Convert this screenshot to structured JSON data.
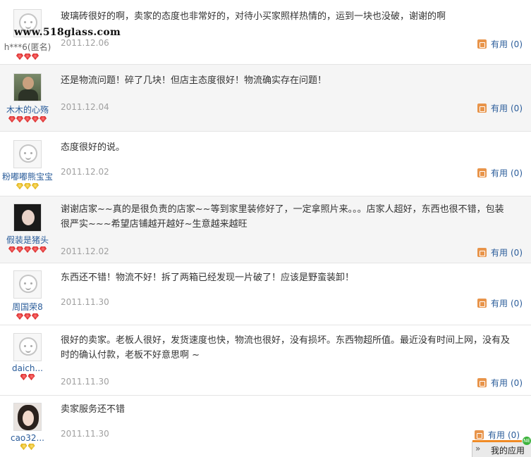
{
  "watermark": "www.518glass.com",
  "useful_label": "有用",
  "reviews": [
    {
      "user": "h***6(匿名)",
      "text": "玻璃砖很好的啊，卖家的态度也非常好的，对待小买家照样热情的，运到一块也没破，谢谢的啊",
      "date": "2011.12.06",
      "useful": "(0)",
      "rank": "red3"
    },
    {
      "user": "木木的心殇",
      "text": "还是物流问题！碎了几块！但店主态度很好！物流确实存在问题！",
      "date": "2011.12.04",
      "useful": "(0)",
      "rank": "red5"
    },
    {
      "user": "粉嘟嘟熊宝宝",
      "text": "态度很好的说。",
      "date": "2011.12.02",
      "useful": "(0)",
      "rank": "gold3"
    },
    {
      "user": "假装是猪头",
      "text": "谢谢店家~~真的是很负责的店家~~等到家里装修好了，一定拿照片来。。。店家人超好，东西也很不错，包装很严实~~~希望店铺越开越好~生意越来越旺",
      "date": "2011.12.02",
      "useful": "(0)",
      "rank": "red5"
    },
    {
      "user": "周国荣8",
      "text": "东西还不错！物流不好！拆了两箱已经发现一片破了！应该是野蛮装卸！",
      "date": "2011.11.30",
      "useful": "(0)",
      "rank": "red3"
    },
    {
      "user": "daich...",
      "text": "很好的卖家。老板人很好，发货速度也快，物流也很好，没有损坏。东西物超所值。最近没有时间上网，没有及时的确认付款，老板不好意思啊 ~",
      "date": "2011.11.30",
      "useful": "(0)",
      "rank": "red2"
    },
    {
      "user": "cao32...",
      "text": "卖家服务还不错",
      "date": "2011.11.30",
      "useful": "(0)",
      "rank": "gold2"
    }
  ],
  "taskbar": {
    "arrows": "»",
    "label": "我的应用",
    "badge": "NE"
  }
}
